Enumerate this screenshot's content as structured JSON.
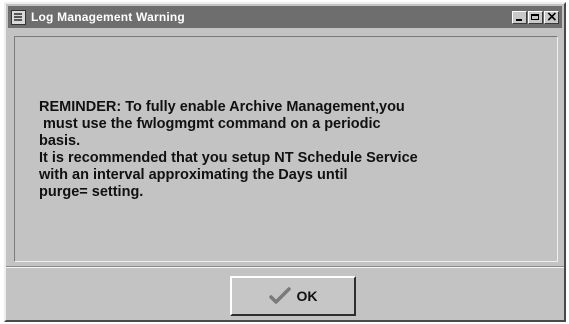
{
  "window": {
    "title": "Log Management Warning"
  },
  "message": {
    "lines": [
      "REMINDER: To fully enable Archive Management,you",
      " must use the fwlogmgmt command on a periodic",
      "basis.",
      "It is recommended that you setup NT Schedule Service",
      "with an interval approximating the Days until",
      "purge= setting."
    ]
  },
  "buttons": {
    "ok_label": "OK"
  },
  "icons": {
    "ok": "checkmark-icon",
    "title": "window-menu-icon"
  },
  "colors": {
    "titlebar": "#6e6e6e",
    "window_bg": "#c3c3c3",
    "checkmark": "#7a7a7a"
  }
}
